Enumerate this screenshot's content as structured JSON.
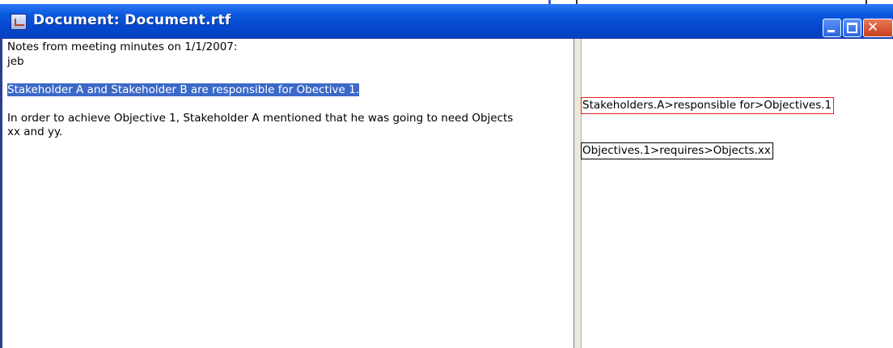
{
  "window": {
    "title": "Document: Document.rtf",
    "controls": [
      "minimize",
      "maximize",
      "close"
    ],
    "close_glyph": "✕"
  },
  "document": {
    "line1": "Notes from meeting minutes on 1/1/2007:",
    "line2": "jeb",
    "selected_sentence": "Stakeholder A and Stakeholder B are responsible for Obective 1.",
    "para2_line1": "In order to achieve Objective 1, Stakeholder A mentioned that he was going to need Objects",
    "para2_line2": "xx and yy."
  },
  "triples": [
    {
      "text": "Stakeholders.A>responsible for>Objectives.1",
      "border_color": "#e02020"
    },
    {
      "text": "Objectives.1>requires>Objects.xx",
      "border_color": "#000000"
    }
  ],
  "colors": {
    "titlebar": "#0a5ae0",
    "selection": "#3b69c8",
    "close_button": "#c8401c"
  }
}
